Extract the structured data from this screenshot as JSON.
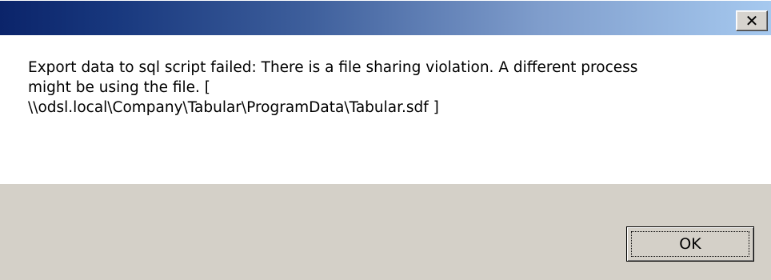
{
  "window": {
    "title": "",
    "close_icon": "close-icon",
    "colors": {
      "titlebar_start": "#0b246a",
      "titlebar_end": "#a6c9ef",
      "footer_background": "#d4d0c8",
      "content_background": "#ffffff"
    }
  },
  "message": {
    "line1": "Export data to sql script failed: There is a file sharing violation. A different process",
    "line2": "might be using the file. [",
    "line3": "\\\\odsl.local\\Company\\Tabular\\ProgramData\\Tabular.sdf ]"
  },
  "buttons": {
    "ok_label": "OK"
  }
}
